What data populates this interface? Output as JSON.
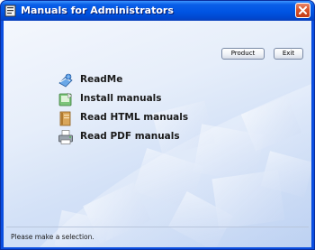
{
  "window": {
    "title": "Manuals for Administrators"
  },
  "toolbar": {
    "product_label": "Product",
    "exit_label": "Exit"
  },
  "menu": {
    "items": [
      {
        "label": "ReadMe",
        "icon": "readme-globe-icon"
      },
      {
        "label": "Install manuals",
        "icon": "install-icon"
      },
      {
        "label": "Read HTML manuals",
        "icon": "html-manual-icon"
      },
      {
        "label": "Read PDF manuals",
        "icon": "pdf-printer-icon"
      }
    ]
  },
  "status": {
    "text": "Please make a selection."
  },
  "colors": {
    "titlebar": "#0054e3",
    "close": "#d9542a",
    "client_bg": "#e6eefa"
  }
}
